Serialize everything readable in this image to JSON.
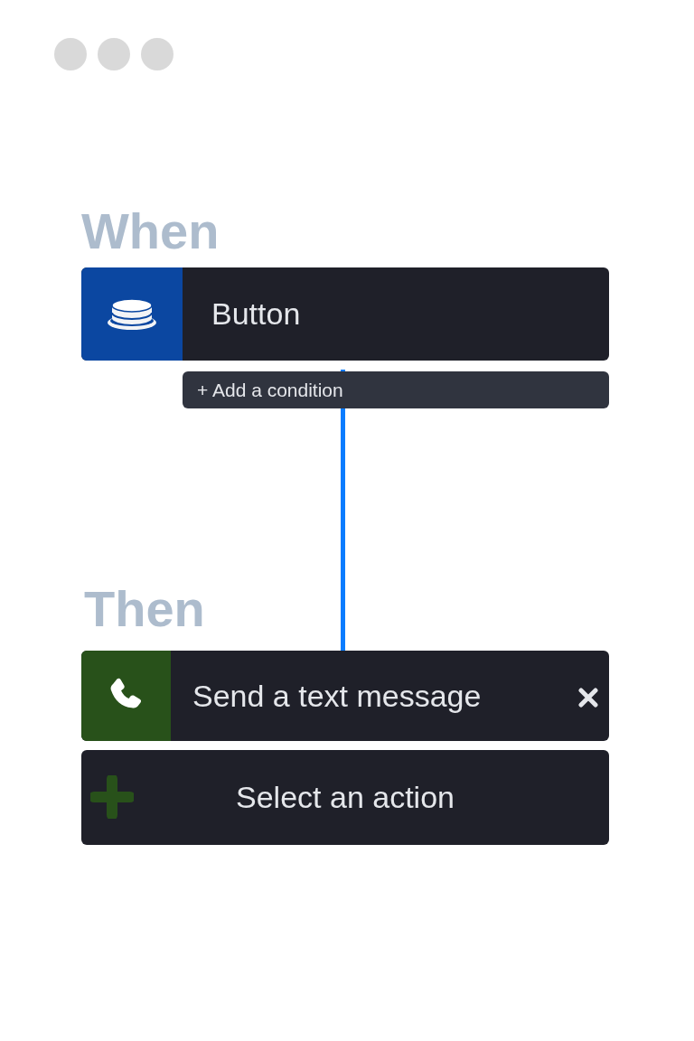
{
  "trigger": {
    "heading": "When",
    "kind": "button",
    "label": "Button",
    "add_condition": "+ Add a condition"
  },
  "actions": {
    "heading": "Then",
    "items": [
      {
        "kind": "sms",
        "label": "Send a text message",
        "removable": true
      }
    ],
    "add_action": "Select an action"
  }
}
